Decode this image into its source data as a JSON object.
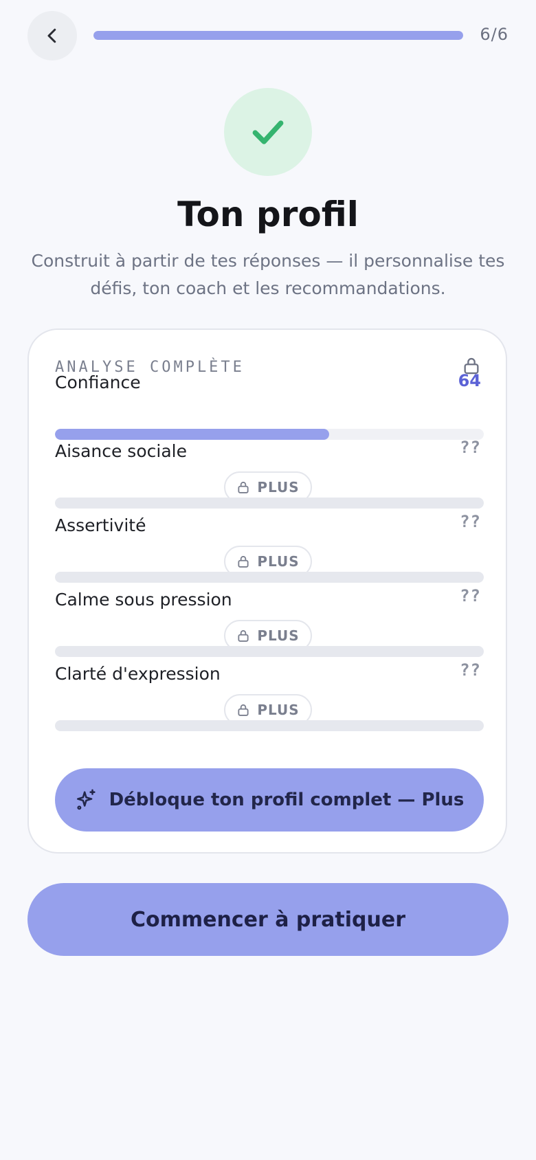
{
  "colors": {
    "accent": "#96a0ec",
    "accent_text": "#5b62d6",
    "success": "#35b46f",
    "success_bg": "#dcf3e5"
  },
  "header": {
    "back_icon": "chevron-left-icon",
    "step_progress": 1.0,
    "step_label": "6/6"
  },
  "hero": {
    "icon": "check-icon",
    "title": "Ton profil",
    "subtitle": "Construit à partir de tes réponses — il personnalise tes défis, ton coach et les recommandations."
  },
  "card": {
    "label": "ANALYSE COMPLÈTE",
    "lock_icon": "lock-icon",
    "metrics": [
      {
        "name": "Confiance",
        "value": "64",
        "progress": 0.64,
        "locked": false
      },
      {
        "name": "Aisance sociale",
        "value": "??",
        "locked": true,
        "badge": "PLUS"
      },
      {
        "name": "Assertivité",
        "value": "??",
        "locked": true,
        "badge": "PLUS"
      },
      {
        "name": "Calme sous pression",
        "value": "??",
        "locked": true,
        "badge": "PLUS"
      },
      {
        "name": "Clarté d'expression",
        "value": "??",
        "locked": true,
        "badge": "PLUS"
      }
    ],
    "unlock_icon": "sparkles-icon",
    "unlock_label": "Débloque ton profil complet — Plus"
  },
  "cta": {
    "label": "Commencer à pratiquer"
  }
}
